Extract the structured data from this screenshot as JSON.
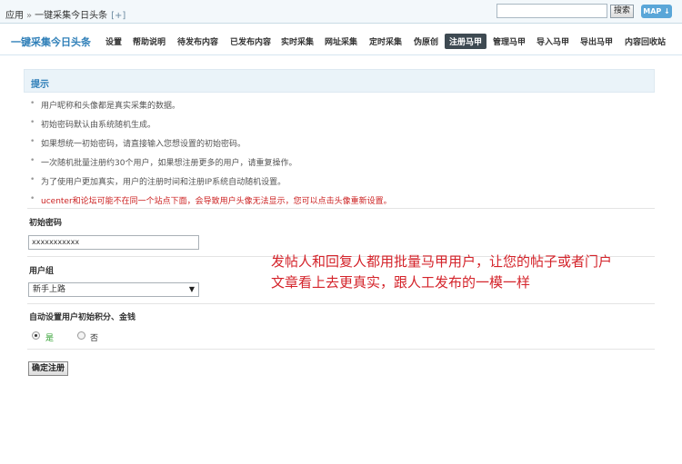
{
  "topbar": {
    "crumb_root": "应用",
    "crumb_sep": "»",
    "crumb_current": "一键采集今日头条",
    "crumb_add": "[+]",
    "search_placeholder": "",
    "search_button": "搜索",
    "map_button": "MAP ↓"
  },
  "nav": {
    "brand": "一键采集今日头条",
    "items": [
      "设置",
      "帮助说明",
      "待发布内容",
      "已发布内容",
      "实时采集",
      "网址采集",
      "定时采集",
      "伪原创",
      "注册马甲",
      "管理马甲",
      "导入马甲",
      "导出马甲",
      "内容回收站"
    ],
    "active": "注册马甲"
  },
  "tips": {
    "title": "提示",
    "items": [
      "用户昵称和头像都是真实采集的数据。",
      "初始密码默认由系统随机生成。",
      "如果想统一初始密码，请直接输入您想设置的初始密码。",
      "一次随机批量注册约30个用户，如果想注册更多的用户，请重复操作。",
      "为了使用户更加真实，用户的注册时间和注册IP系统自动随机设置。",
      "ucenter和论坛可能不在同一个站点下面，会导致用户头像无法显示，您可以点击头像重新设置。"
    ]
  },
  "form": {
    "password_label": "初始密码",
    "password_value": "xxxxxxxxxxx",
    "group_label": "用户组",
    "group_selected": "新手上路",
    "auto_label": "自动设置用户初始积分、金钱",
    "radio_yes": "是",
    "radio_no": "否",
    "radio_selected": "是",
    "submit_label": "确定注册"
  },
  "annotation": {
    "line1": "发帖人和回复人都用批量马甲用户，让您的帖子或者门户",
    "line2": "文章看上去更真实，跟人工发布的一模一样"
  },
  "colors": {
    "brand": "#2f7fb8",
    "warning": "#cc2222",
    "annotation": "#d4232a",
    "yes_label": "#2a9d2a"
  }
}
